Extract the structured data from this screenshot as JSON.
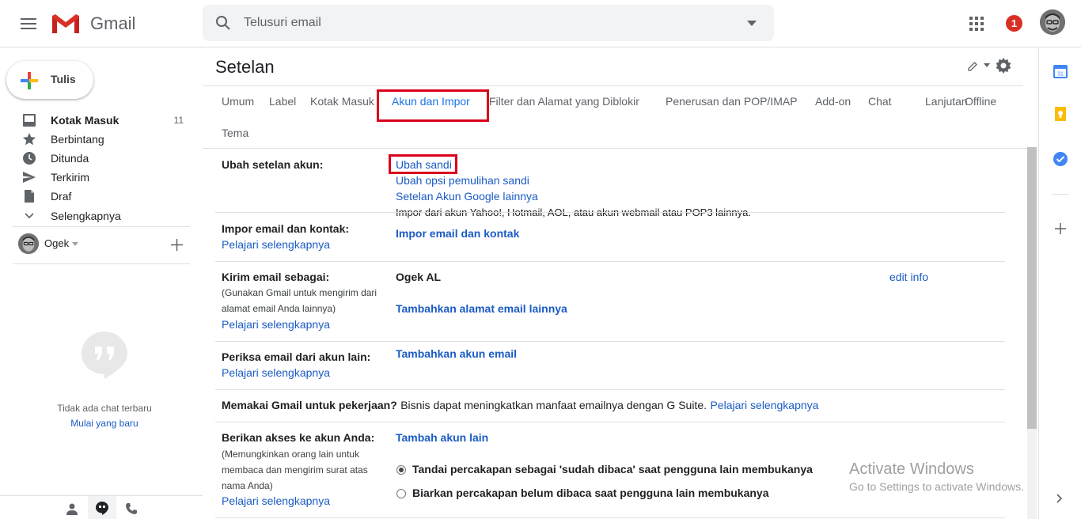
{
  "header": {
    "app_name": "Gmail",
    "search_placeholder": "Telusuri email",
    "notification_count": "1"
  },
  "nav": {
    "compose_label": "Tulis",
    "items": [
      {
        "label": "Kotak Masuk",
        "count": "11",
        "icon": "inbox-icon"
      },
      {
        "label": "Berbintang",
        "icon": "star-icon"
      },
      {
        "label": "Ditunda",
        "icon": "clock-icon"
      },
      {
        "label": "Terkirim",
        "icon": "send-icon"
      },
      {
        "label": "Draf",
        "icon": "draft-icon"
      },
      {
        "label": "Selengkapnya",
        "icon": "chevron-down-icon"
      }
    ],
    "hangouts_user": "Ogek",
    "no_chat_text": "Tidak ada chat terbaru",
    "start_chat_link": "Mulai yang baru"
  },
  "settings": {
    "title": "Setelan",
    "tabs": [
      "Umum",
      "Label",
      "Kotak Masuk",
      "Akun dan Impor",
      "Filter dan Alamat yang Diblokir",
      "Penerusan dan POP/IMAP",
      "Add-on",
      "Chat",
      "Lanjutan",
      "Offline",
      "Tema"
    ],
    "active_tab": "Akun dan Impor",
    "sections": {
      "change_account": {
        "label": "Ubah setelan akun:",
        "links": [
          "Ubah sandi",
          "Ubah opsi pemulihan sandi",
          "Setelan Akun Google lainnya"
        ]
      },
      "import": {
        "label": "Impor email dan kontak:",
        "learn_more": "Pelajari selengkapnya",
        "description": "Impor dari akun Yahoo!, Hotmail, AOL, atau akun webmail atau POP3 lainnya.",
        "action": "Impor email dan kontak"
      },
      "send_as": {
        "label": "Kirim email sebagai:",
        "note": "(Gunakan Gmail untuk mengirim dari alamat email Anda lainnya)",
        "learn_more": "Pelajari selengkapnya",
        "account_name": "Ogek AL",
        "edit_info": "edit info",
        "action": "Tambahkan alamat email lainnya"
      },
      "check_mail": {
        "label": "Periksa email dari akun lain:",
        "learn_more": "Pelajari selengkapnya",
        "action": "Tambahkan akun email"
      },
      "work": {
        "label": "Memakai Gmail untuk pekerjaan?",
        "text": "Bisnis dapat meningkatkan manfaat emailnya dengan G Suite.",
        "learn_more": "Pelajari selengkapnya"
      },
      "grant_access": {
        "label": "Berikan akses ke akun Anda:",
        "note": "(Memungkinkan orang lain untuk membaca dan mengirim surat atas nama Anda)",
        "learn_more": "Pelajari selengkapnya",
        "action": "Tambah akun lain",
        "option_read": "Tandai percakapan sebagai 'sudah dibaca' saat pengguna lain membukanya",
        "option_unread": "Biarkan percakapan belum dibaca saat pengguna lain membukanya"
      }
    }
  },
  "watermark": {
    "title": "Activate Windows",
    "subtitle": "Go to Settings to activate Windows."
  }
}
